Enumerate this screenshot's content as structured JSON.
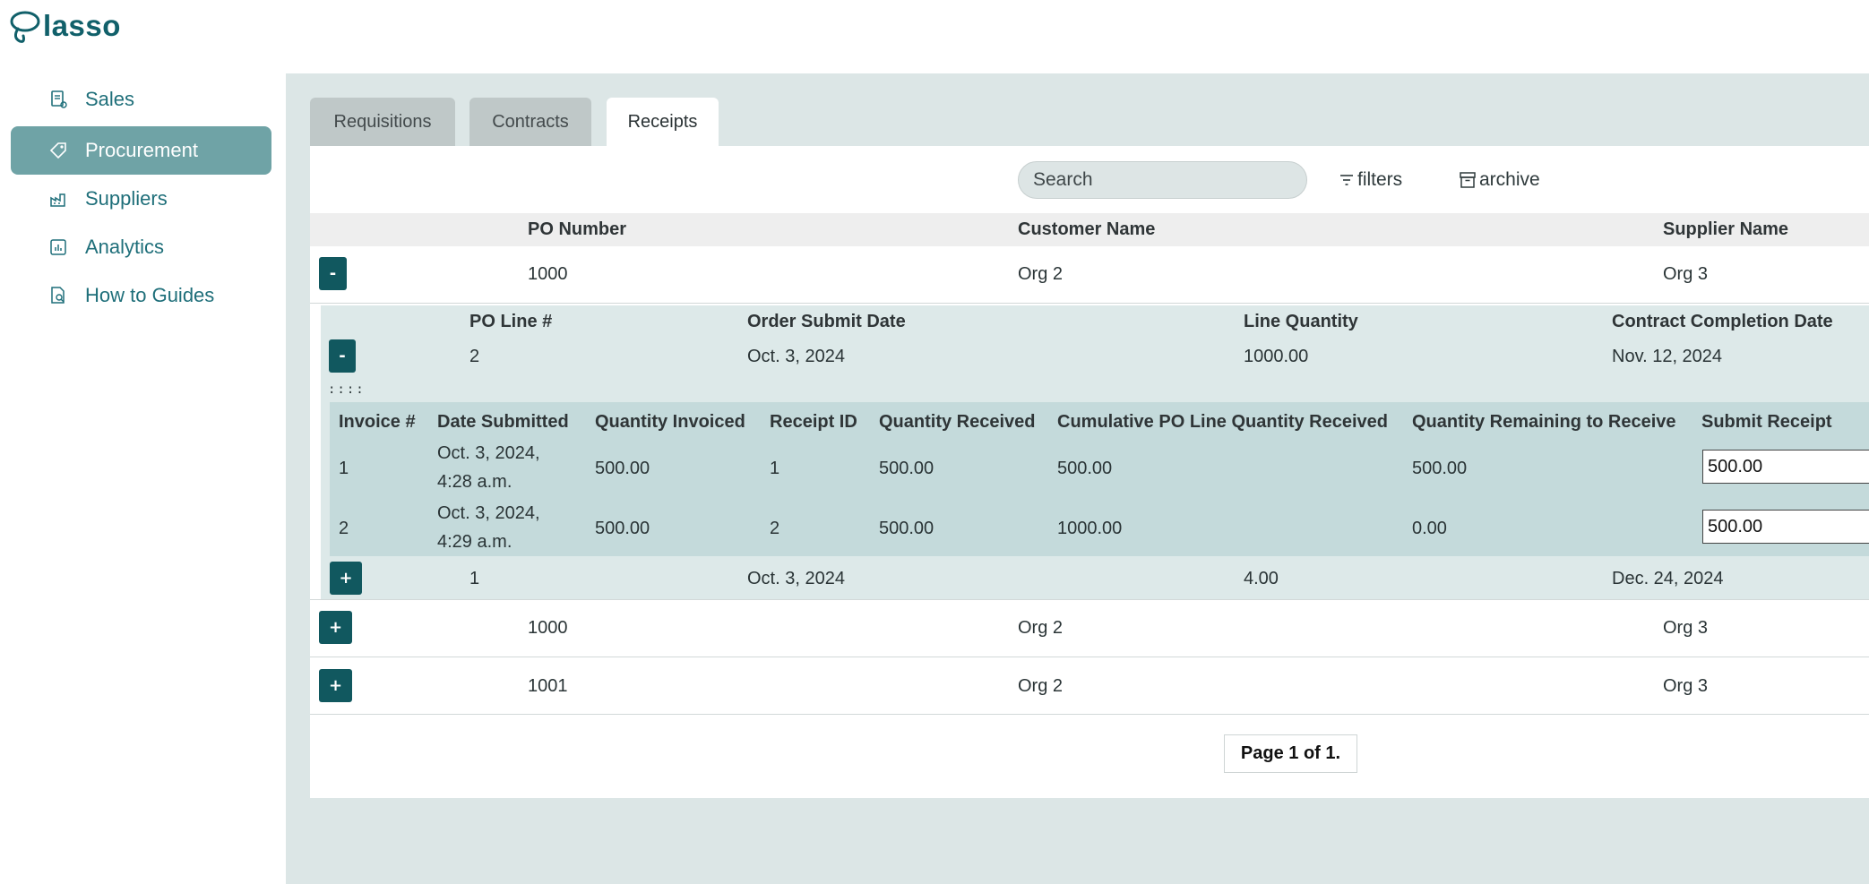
{
  "app": {
    "name": "lasso"
  },
  "sidebar": {
    "items": [
      {
        "label": "Sales",
        "icon": "receipt-icon"
      },
      {
        "label": "Procurement",
        "icon": "tag-icon",
        "active": true
      },
      {
        "label": "Suppliers",
        "icon": "factory-icon"
      },
      {
        "label": "Analytics",
        "icon": "chart-icon"
      },
      {
        "label": "How to Guides",
        "icon": "guide-icon"
      }
    ]
  },
  "tabs": [
    {
      "label": "Requisitions"
    },
    {
      "label": "Contracts"
    },
    {
      "label": "Receipts",
      "active": true
    }
  ],
  "toolbar": {
    "search_placeholder": "Search",
    "filters_label": "filters",
    "archive_label": "archive"
  },
  "table": {
    "columns": [
      "PO Number",
      "Customer Name",
      "Supplier Name"
    ],
    "rows": [
      {
        "toggle": "-",
        "po_number": "1000",
        "customer": "Org 2",
        "supplier": "Org 3",
        "lines": {
          "columns": [
            "PO Line #",
            "Order Submit Date",
            "Line Quantity",
            "Contract Completion Date"
          ],
          "rows": [
            {
              "toggle": "-",
              "line_no": "2",
              "submit_date": "Oct. 3, 2024",
              "quantity": "1000.00",
              "completion_date": "Nov. 12, 2024",
              "drag_handle": "::::",
              "receipts": {
                "columns": [
                  "Invoice #",
                  "Date Submitted",
                  "Quantity Invoiced",
                  "Receipt ID",
                  "Quantity Received",
                  "Cumulative PO Line Quantity Received",
                  "Quantity Remaining to Receive",
                  "Submit Receipt"
                ],
                "rows": [
                  {
                    "invoice": "1",
                    "date_line1": "Oct. 3, 2024,",
                    "date_line2": "4:28 a.m.",
                    "qty_invoiced": "500.00",
                    "receipt_id": "1",
                    "qty_received": "500.00",
                    "cumulative": "500.00",
                    "remaining": "500.00",
                    "submit_value": "500.00"
                  },
                  {
                    "invoice": "2",
                    "date_line1": "Oct. 3, 2024,",
                    "date_line2": "4:29 a.m.",
                    "qty_invoiced": "500.00",
                    "receipt_id": "2",
                    "qty_received": "500.00",
                    "cumulative": "1000.00",
                    "remaining": "0.00",
                    "submit_value": "500.00"
                  }
                ]
              }
            },
            {
              "toggle": "+",
              "line_no": "1",
              "submit_date": "Oct. 3, 2024",
              "quantity": "4.00",
              "completion_date": "Dec. 24, 2024"
            }
          ]
        }
      },
      {
        "toggle": "+",
        "po_number": "1000",
        "customer": "Org 2",
        "supplier": "Org 3"
      },
      {
        "toggle": "+",
        "po_number": "1001",
        "customer": "Org 2",
        "supplier": "Org 3"
      }
    ]
  },
  "pagination": {
    "label": "Page 1 of 1."
  },
  "colors": {
    "brand": "#11606a",
    "button": "#11585f",
    "active_nav": "#6fa3a6",
    "panel_bg": "#dce6e6"
  }
}
